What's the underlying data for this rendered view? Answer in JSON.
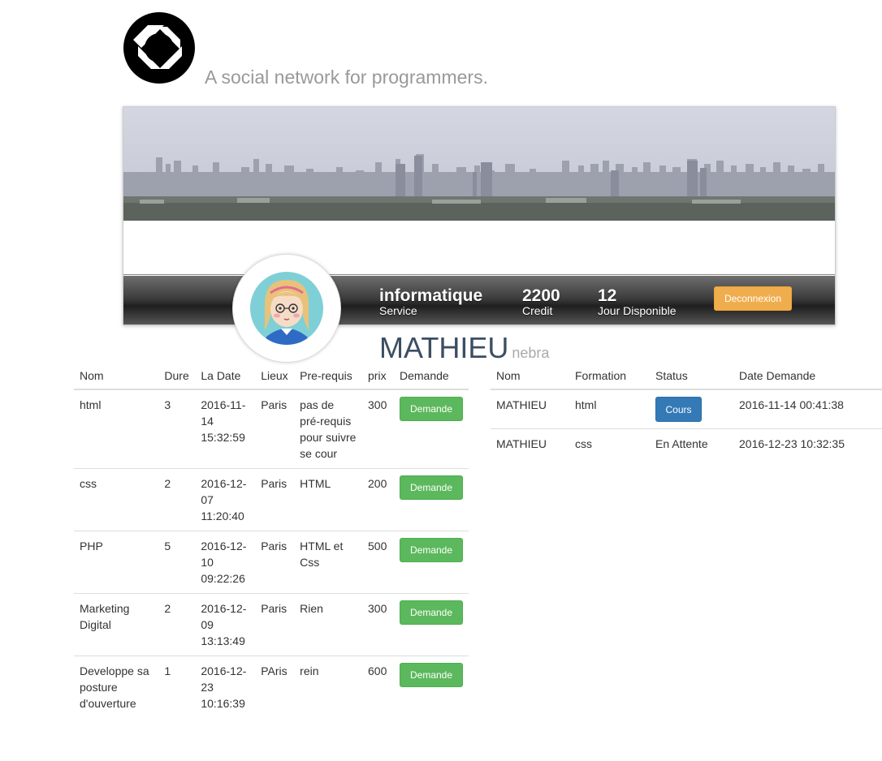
{
  "header": {
    "logo_icon": "shutter-aperture-icon",
    "tagline": "A social network for programmers."
  },
  "profile": {
    "service_value": "informatique",
    "service_label": "Service",
    "credit_value": "2200",
    "credit_label": "Credit",
    "days_value": "12",
    "days_label": "Jour Disponible",
    "logout_label": "Deconnexion",
    "name": "MATHIEU",
    "nickname": "nebra"
  },
  "colors": {
    "demande_button": "#5cb85c",
    "logout_button": "#f0ad4e",
    "cours_button": "#337ab7",
    "name_text": "#3b4e63"
  },
  "courses": {
    "headers": [
      "Nom",
      "Dure",
      "La Date",
      "Lieux",
      "Pre-requis",
      "prix",
      "Demande"
    ],
    "rows": [
      {
        "nom": "html",
        "dure": "3",
        "date": "2016-11-14 15:32:59",
        "lieux": "Paris",
        "prereq": "pas de pré-requis pour suivre se cour",
        "prix": "300",
        "action": "Demande"
      },
      {
        "nom": "css",
        "dure": "2",
        "date": "2016-12-07 11:20:40",
        "lieux": "Paris",
        "prereq": "HTML",
        "prix": "200",
        "action": "Demande"
      },
      {
        "nom": "PHP",
        "dure": "5",
        "date": "2016-12-10 09:22:26",
        "lieux": "Paris",
        "prereq": "HTML et Css",
        "prix": "500",
        "action": "Demande"
      },
      {
        "nom": "Marketing Digital",
        "dure": "2",
        "date": "2016-12-09 13:13:49",
        "lieux": "Paris",
        "prereq": "Rien",
        "prix": "300",
        "action": "Demande"
      },
      {
        "nom": "Developpe sa posture d'ouverture",
        "dure": "1",
        "date": "2016-12-23 10:16:39",
        "lieux": "PAris",
        "prereq": "rein",
        "prix": "600",
        "action": "Demande"
      }
    ]
  },
  "requests": {
    "headers": [
      "Nom",
      "Formation",
      "Status",
      "Date Demande"
    ],
    "rows": [
      {
        "nom": "MATHIEU",
        "formation": "html",
        "status": "Cours",
        "status_is_button": true,
        "date": "2016-11-14 00:41:38"
      },
      {
        "nom": "MATHIEU",
        "formation": "css",
        "status": "En Attente",
        "status_is_button": false,
        "date": "2016-12-23 10:32:35"
      }
    ]
  }
}
